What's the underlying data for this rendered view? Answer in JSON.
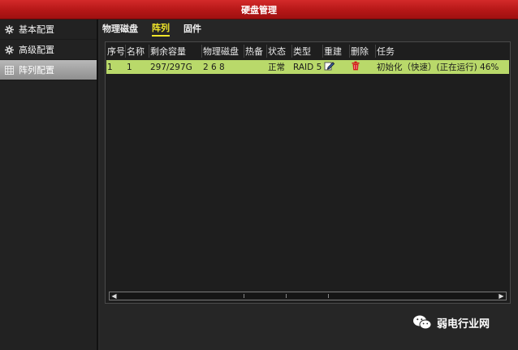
{
  "window": {
    "title": "硬盘管理"
  },
  "sidebar": {
    "items": [
      {
        "label": "基本配置",
        "icon": "gear-icon",
        "active": false
      },
      {
        "label": "高级配置",
        "icon": "gear-icon",
        "active": false
      },
      {
        "label": "阵列配置",
        "icon": "grid-icon",
        "active": true
      }
    ]
  },
  "tabs": [
    {
      "label": "物理磁盘",
      "active": false
    },
    {
      "label": "阵列",
      "active": true
    },
    {
      "label": "固件",
      "active": false
    }
  ],
  "table": {
    "columns": [
      "序号",
      "名称",
      "剩余容量",
      "物理磁盘",
      "热备",
      "状态",
      "类型",
      "重建",
      "删除",
      "任务"
    ],
    "rows": [
      {
        "index": "1",
        "name": "1",
        "free_capacity": "297/297G",
        "physical_disks": "2 6 8",
        "hot_spare": "",
        "status": "正常",
        "type": "RAID 5",
        "rebuild_icon": "edit-icon",
        "delete_icon": "trash-icon",
        "task": "初始化（快速）(正在运行) 46%"
      }
    ]
  },
  "watermark": {
    "text": "弱电行业网",
    "icon": "wechat-icon"
  }
}
